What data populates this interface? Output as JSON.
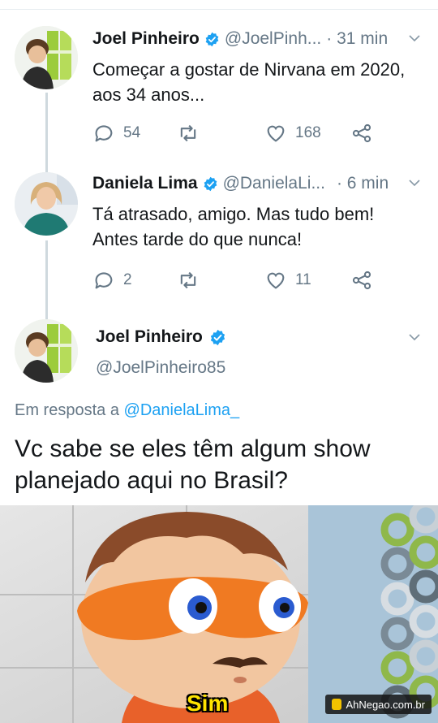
{
  "tweets": [
    {
      "name": "Joel Pinheiro",
      "handle": "@JoelPinh...",
      "time": "· 31 min",
      "text": [
        "Começar a gostar de Nirvana em 2020,",
        "aos 34 anos..."
      ],
      "replies": "54",
      "retweets": "",
      "likes": "168"
    },
    {
      "name": "Daniela Lima",
      "handle": "@DanielaLi...",
      "time": "· 6 min",
      "text": [
        "Tá atrasado, amigo. Mas tudo bem!",
        "Antes tarde do que nunca!"
      ],
      "replies": "2",
      "retweets": "",
      "likes": "11"
    }
  ],
  "main_tweet": {
    "name": "Joel Pinheiro",
    "handle": "@JoelPinheiro85",
    "reply_prefix": "Em resposta a",
    "reply_to": "@DanielaLima_",
    "text": [
      "Vc sabe se eles têm algum show",
      "planejado aqui no Brasil?"
    ]
  },
  "meme": {
    "caption": "Sim",
    "watermark": "AhNegao.com.br"
  },
  "colors": {
    "verified": "#1da1f2",
    "muted": "#657786",
    "link": "#1da1f2"
  }
}
